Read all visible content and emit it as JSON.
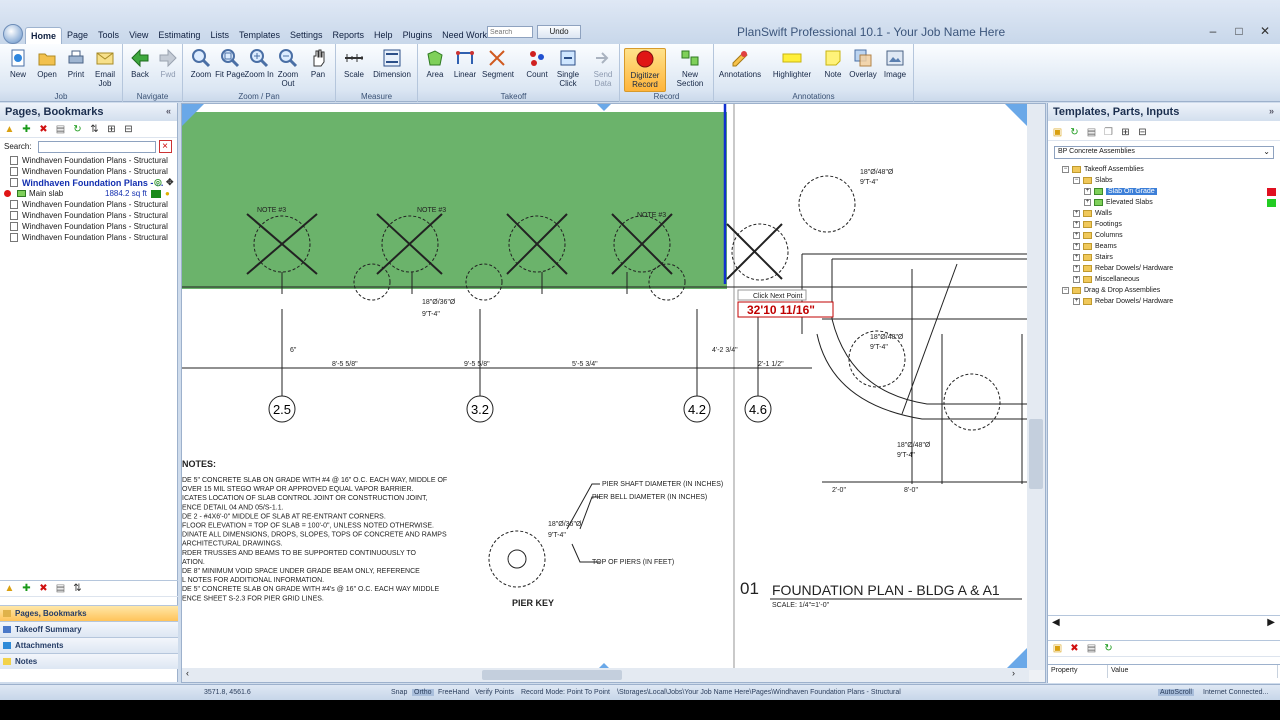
{
  "window": {
    "title": "PlanSwift Professional 10.1 - Your Job Name Here",
    "search_placeholder": "Search",
    "undo_label": "Undo"
  },
  "menu": [
    "Home",
    "Page",
    "Tools",
    "View",
    "Estimating",
    "Lists",
    "Templates",
    "Settings",
    "Reports",
    "Help",
    "Plugins",
    "Need Work?"
  ],
  "ribbon": {
    "groups": {
      "job": "Job",
      "navigate": "Navigate",
      "zoom_pan": "Zoom / Pan",
      "measure": "Measure",
      "takeoff": "Takeoff",
      "record": "Record",
      "annotations": "Annotations"
    },
    "buttons": {
      "new": "New",
      "open": "Open",
      "print": "Print",
      "email_job": "Email Job",
      "back": "Back",
      "fwd": "Fwd",
      "zoom": "Zoom",
      "fit_page": "Fit Page",
      "zoom_in": "Zoom In",
      "zoom_out": "Zoom Out",
      "pan": "Pan",
      "scale": "Scale",
      "dimension": "Dimension",
      "area": "Area",
      "linear": "Linear",
      "segment": "Segment",
      "count": "Count",
      "single_click": "Single Click",
      "send_data": "Send Data",
      "digitizer_record": "Digitizer Record",
      "new_section": "New Section",
      "annotations": "Annotations",
      "highlighter": "Highlighter",
      "note": "Note",
      "overlay": "Overlay",
      "image": "Image"
    }
  },
  "left_panel": {
    "title": "Pages, Bookmarks",
    "search_label": "Search:",
    "pages": [
      "Windhaven Foundation Plans - Structural",
      "Windhaven Foundation Plans - Structural",
      "Windhaven Foundation Plans - ...",
      "Windhaven Foundation Plans - Structural",
      "Windhaven Foundation Plans - Structural",
      "Windhaven Foundation Plans - Structural",
      "Windhaven Foundation Plans - Structural"
    ],
    "takeoff_item": {
      "name": "Main slab",
      "value": "1884.2 sq ft"
    },
    "tabs": [
      "Pages, Bookmarks",
      "Takeoff Summary",
      "Attachments",
      "Notes"
    ]
  },
  "right_panel": {
    "title": "Templates, Parts, Inputs",
    "dropdown": "BP Concrete Assemblies",
    "tree": [
      {
        "label": "Takeoff Assemblies",
        "level": 0,
        "kind": "folder"
      },
      {
        "label": "Slabs",
        "level": 1,
        "kind": "folder"
      },
      {
        "label": "Slab On Grade",
        "level": 2,
        "kind": "leaf",
        "selected": true,
        "color": "#e01020"
      },
      {
        "label": "Elevated Slabs",
        "level": 2,
        "kind": "leaf",
        "color": "#22cc22"
      },
      {
        "label": "Walls",
        "level": 1,
        "kind": "folder"
      },
      {
        "label": "Footings",
        "level": 1,
        "kind": "folder"
      },
      {
        "label": "Columns",
        "level": 1,
        "kind": "folder"
      },
      {
        "label": "Beams",
        "level": 1,
        "kind": "folder"
      },
      {
        "label": "Stairs",
        "level": 1,
        "kind": "folder"
      },
      {
        "label": "Rebar Dowels/ Hardware",
        "level": 1,
        "kind": "folder"
      },
      {
        "label": "Miscellaneous",
        "level": 1,
        "kind": "folder"
      },
      {
        "label": "Drag & Drop Assemblies",
        "level": 0,
        "kind": "folder"
      },
      {
        "label": "Rebar Dowels/ Hardware",
        "level": 1,
        "kind": "folder"
      }
    ],
    "property_header": "Property",
    "value_header": "Value"
  },
  "drawing": {
    "measurement": "32'10 11/16\"",
    "hint": "Click Next Point",
    "grid_labels": [
      "2.5",
      "3.2",
      "4.2",
      "4.6"
    ],
    "title_number": "01",
    "title": "FOUNDATION PLAN - BLDG A & A1",
    "scale": "SCALE: 1/4\"=1'-0\"",
    "pier_key": "PIER KEY",
    "pier_shaft": "PIER SHAFT DIAMETER (IN INCHES)",
    "pier_bell": "PIER BELL DIAMETER (IN INCHES)",
    "top_of_piers": "TOP OF PIERS (IN FEET)",
    "notes_heading": "NOTES:",
    "notes": [
      "DE 5\" CONCRETE SLAB ON GRADE WITH #4 @ 16\" O.C. EACH WAY, MIDDLE OF",
      "OVER 15 MIL STEGO WRAP OR APPROVED EQUAL VAPOR BARRIER.",
      "ICATES LOCATION OF SLAB CONTROL JOINT OR CONSTRUCTION JOINT,",
      "ENCE DETAIL 04 AND 05/S-1.1.",
      "DE 2 - #4X6'-0\" MIDDLE OF SLAB AT RE-ENTRANT CORNERS.",
      "FLOOR ELEVATION = TOP OF SLAB = 100'-0\", UNLESS NOTED OTHERWISE.",
      "DINATE ALL DIMENSIONS, DROPS, SLOPES, TOPS OF CONCRETE AND RAMPS",
      "ARCHITECTURAL DRAWINGS.",
      "RDER TRUSSES AND BEAMS TO BE SUPPORTED CONTINUOUSLY TO",
      "ATION.",
      "DE 8\" MINIMUM VOID SPACE UNDER GRADE BEAM ONLY, REFERENCE",
      "L NOTES FOR ADDITIONAL INFORMATION.",
      "DE 5\" CONCRETE SLAB ON GRADE WITH #4's @ 16\" O.C. EACH WAY MIDDLE",
      "ENCE SHEET S-2.3 FOR PIER GRID LINES."
    ],
    "pier_labels": [
      "18\"Ø/36\"Ø",
      "9'T-4\"",
      "18\"Ø/48\"Ø",
      "9'T-4\""
    ],
    "note_label": "NOTE #3",
    "dims": [
      "8'-5 5/8\"",
      "9'-5 5/8\"",
      "5'-5 3/4\"",
      "4'-2 3/4\"",
      "2'-1 1/2\"",
      "2'-0\"",
      "8'-0\"",
      "6\""
    ]
  },
  "status": {
    "coords": "3571.8, 4561.6",
    "snap": "Snap",
    "ortho": "Ortho",
    "freehand": "FreeHand",
    "verify": "Verify Points",
    "record_mode": "Record Mode: Point To Point",
    "path": "\\Storages\\Local\\Jobs\\Your Job Name Here\\Pages\\Windhaven Foundation Plans - Structural",
    "autoscroll": "AutoScroll",
    "internet": "Internet Connected..."
  },
  "colors": {
    "area_fill": "#3a9a3a",
    "measure_line": "#1030d0",
    "measure_text": "#c00000",
    "ribbon_selected": "#ffb43a"
  }
}
